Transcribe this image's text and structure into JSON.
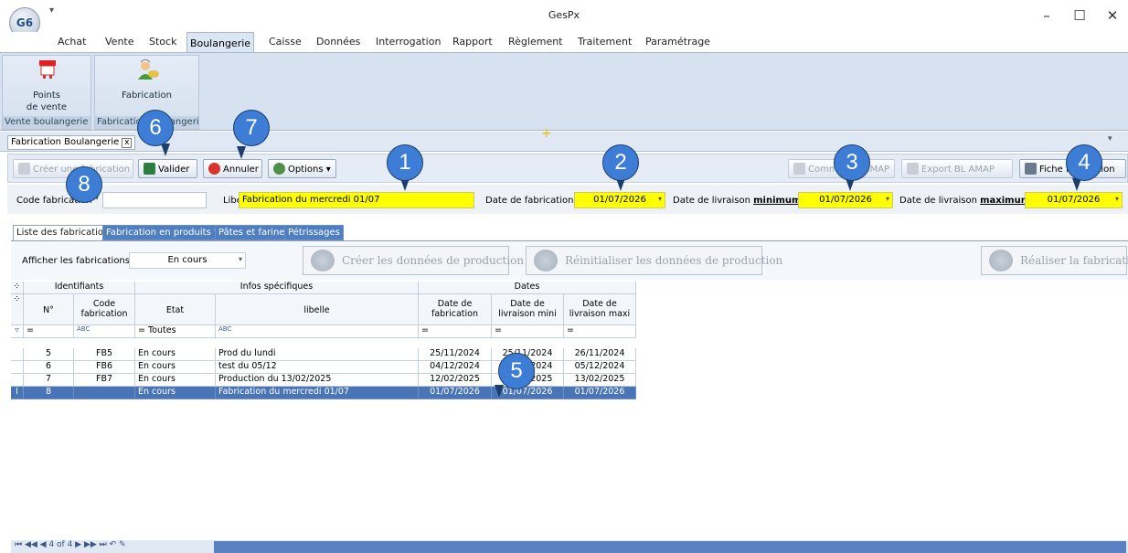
{
  "app": {
    "title": "GesPx",
    "logo": "G6"
  },
  "menu": [
    "Achat",
    "Vente",
    "Stock",
    "Boulangerie",
    "Caisse",
    "Données",
    "Interrogation",
    "Rapport",
    "Règlement",
    "Traitement",
    "Paramétrage"
  ],
  "ribbon": {
    "points_label": "Points de vente",
    "points_line1": "Points",
    "points_line2": "de vente",
    "fabrication_label": "Fabrication",
    "group1_label": "Vente boulangerie",
    "group2_label": "Fabrication boulangerie"
  },
  "doc_tab": {
    "label": "Fabrication Boulangerie",
    "close": "x"
  },
  "toolbar": {
    "creer": "Créer une fabrication",
    "valider": "Valider",
    "annuler": "Annuler",
    "options": "Options",
    "commande_amap": "Commande AMAP",
    "export_bl_amap": "Export BL AMAP",
    "fiche_fabrication": "Fiche fabrication"
  },
  "form": {
    "code_label": "Code fabrication",
    "code_value": "",
    "libelle_label": "Libellé",
    "libelle_value": "Fabrication du mercredi 01/07",
    "date_fab_label": "Date de fabrication :",
    "date_fab_value": "01/07/2026",
    "date_min_label_prefix": "Date de livraison",
    "date_min_label_bold": "minimum",
    "date_min_value": "01/07/2026",
    "date_max_label_prefix": "Date de livraison",
    "date_max_label_bold": "maximum",
    "date_max_value": "01/07/2026",
    "colon": ":"
  },
  "subtabs": [
    "Liste des fabrications",
    "Fabrication en produits finis",
    "Pâtes et farines",
    "Pétrissages"
  ],
  "panel": {
    "afficher_label": "Afficher les fabrications :",
    "afficher_value": "En cours",
    "btn_creer_donnees": "Créer les données de production",
    "btn_reinit_donnees": "Réinitialiser les données de production",
    "btn_realiser": "Réaliser la fabrication"
  },
  "grid": {
    "band_identifiants": "Identifiants",
    "band_infos": "Infos spécifiques",
    "band_dates": "Dates",
    "col_no": "N°",
    "col_code": "Code fabrication",
    "col_etat": "Etat",
    "col_libelle": "libelle",
    "col_date_fab": "Date de fabrication",
    "col_date_min": "Date de livraison mini",
    "col_date_max": "Date de livraison maxi",
    "filter_eq": "=",
    "filter_toutes": "= Toutes",
    "filter_abc": "ABC",
    "rows": [
      {
        "no": "5",
        "code": "FB5",
        "etat": "En cours",
        "libelle": "Prod du lundi",
        "fab": "25/11/2024",
        "min": "25/11/2024",
        "max": "26/11/2024"
      },
      {
        "no": "6",
        "code": "FB6",
        "etat": "En cours",
        "libelle": "test du 05/12",
        "fab": "04/12/2024",
        "min": "04/12/2024",
        "max": "05/12/2024"
      },
      {
        "no": "7",
        "code": "FB7",
        "etat": "En cours",
        "libelle": "Production du 13/02/2025",
        "fab": "12/02/2025",
        "min": "12/02/2025",
        "max": "13/02/2025"
      },
      {
        "no": "8",
        "code": "",
        "etat": "En cours",
        "libelle": "Fabrication du mercredi 01/07",
        "fab": "01/07/2026",
        "min": "01/07/2026",
        "max": "01/07/2026"
      }
    ]
  },
  "nav": {
    "text": "4 of 4"
  },
  "callouts": [
    "1",
    "2",
    "3",
    "4",
    "5",
    "6",
    "7",
    "8"
  ]
}
